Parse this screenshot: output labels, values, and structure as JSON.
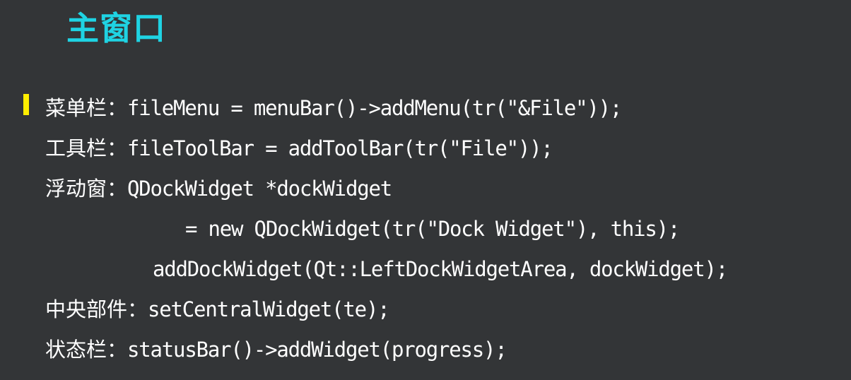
{
  "title": "主窗口",
  "colors": {
    "background": "#333537",
    "title": "#1fd3e3",
    "text": "#ffffff",
    "bullet": "#ffee00"
  },
  "lines": [
    {
      "label": "菜单栏：",
      "code": "fileMenu = menuBar()->addMenu(tr(\"&File\"));"
    },
    {
      "label": "工具栏：",
      "code": "fileToolBar = addToolBar(tr(\"File\"));"
    },
    {
      "label": "浮动窗：",
      "code": "QDockWidget *dockWidget"
    },
    {
      "label": "",
      "code": "= new QDockWidget(tr(\"Dock Widget\"), this);"
    },
    {
      "label": "",
      "code": "addDockWidget(Qt::LeftDockWidgetArea, dockWidget);"
    },
    {
      "label": "中央部件：",
      "code": "setCentralWidget(te);"
    },
    {
      "label": "状态栏：",
      "code": "statusBar()->addWidget(progress);"
    }
  ]
}
